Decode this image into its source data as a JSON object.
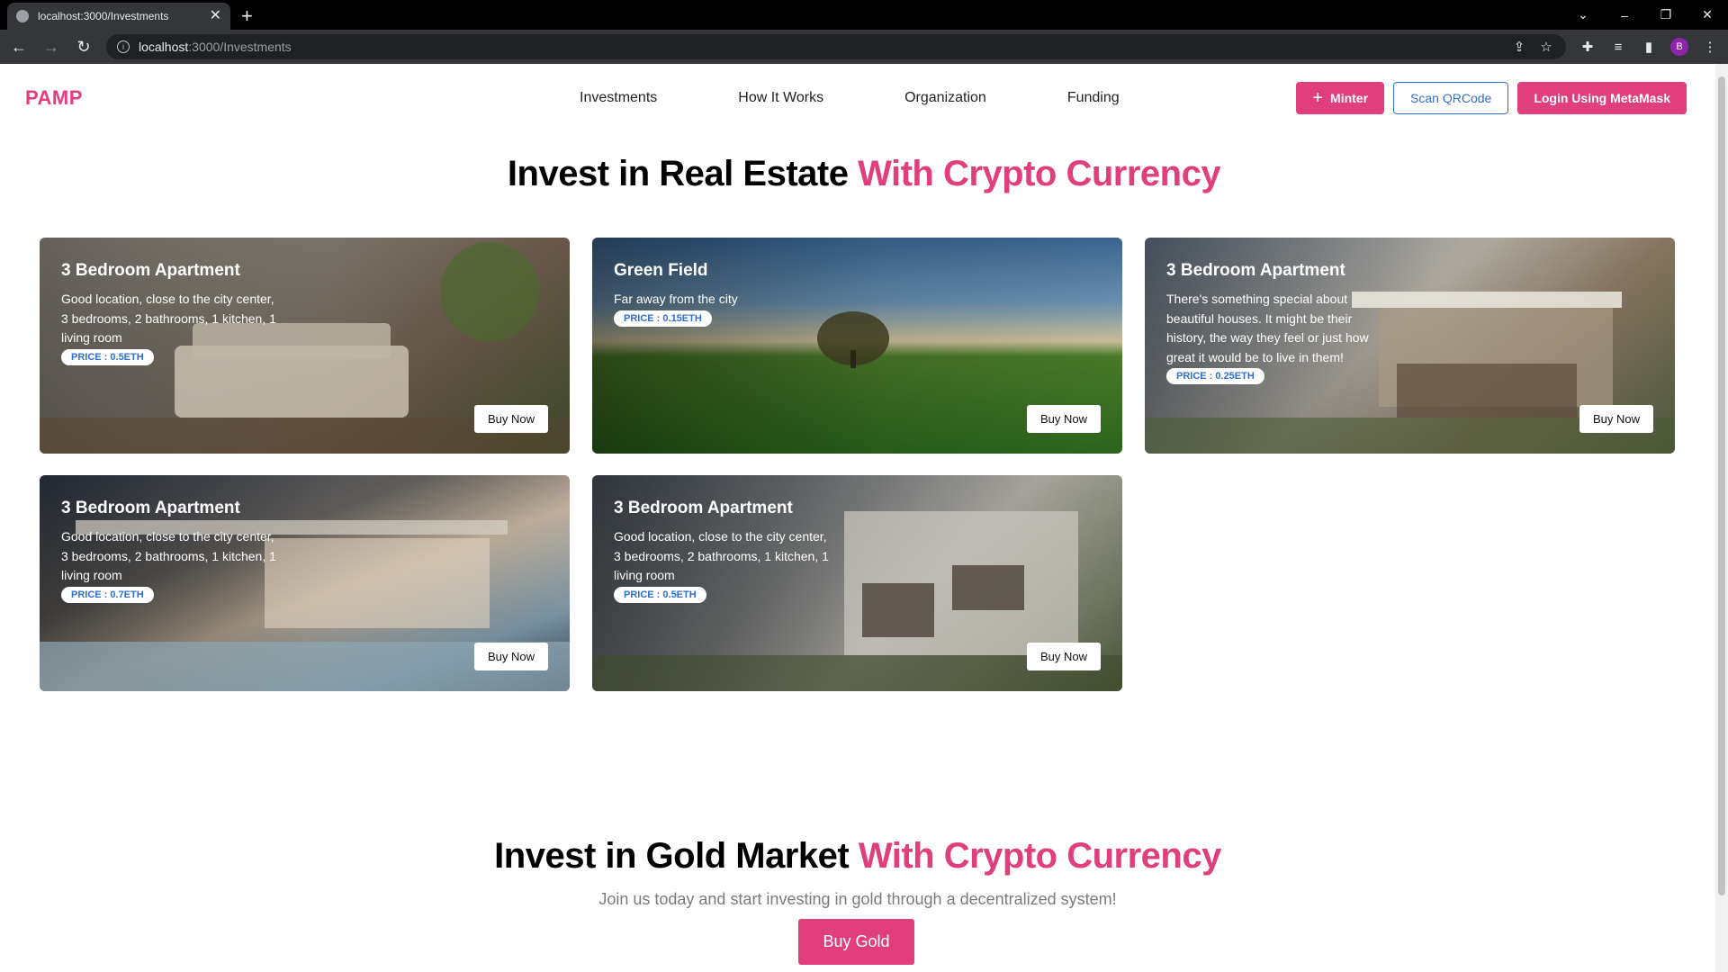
{
  "browser": {
    "tab_title": "localhost:3000/Investments",
    "url_host": "localhost",
    "url_path": ":3000/Investments",
    "profile_initial": "B"
  },
  "header": {
    "logo": "PAMP",
    "nav": [
      "Investments",
      "How It Works",
      "Organization",
      "Funding"
    ],
    "minter_label": "Minter",
    "scan_label": "Scan QRCode",
    "login_label": "Login Using MetaMask"
  },
  "hero": {
    "title_main": "Invest in Real Estate ",
    "title_accent": "With Crypto Currency"
  },
  "cards": [
    {
      "title": "3 Bedroom Apartment",
      "desc": "Good location, close to the city center, 3 bedrooms, 2 bathrooms, 1 kitchen, 1 living room",
      "price": "PRICE : 0.5ETH",
      "button": "Buy Now"
    },
    {
      "title": "Green Field",
      "desc": "Far away from the city",
      "price": "PRICE : 0.15ETH",
      "button": "Buy Now"
    },
    {
      "title": "3 Bedroom Apartment",
      "desc": "There's something special about beautiful houses. It might be their history, the way they feel or just how great it would be to live in them!",
      "price": "PRICE : 0.25ETH",
      "button": "Buy Now"
    },
    {
      "title": "3 Bedroom Apartment",
      "desc": "Good location, close to the city center, 3 bedrooms, 2 bathrooms, 1 kitchen, 1 living room",
      "price": "PRICE : 0.7ETH",
      "button": "Buy Now"
    },
    {
      "title": "3 Bedroom Apartment",
      "desc": "Good location, close to the city center, 3 bedrooms, 2 bathrooms, 1 kitchen, 1 living room",
      "price": "PRICE : 0.5ETH",
      "button": "Buy Now"
    }
  ],
  "gold": {
    "title_main": "Invest in Gold Market ",
    "title_accent": "With Crypto Currency",
    "subtitle": "Join us today and start investing in gold through a decentralized system!",
    "button": "Buy Gold"
  },
  "colors": {
    "accent": "#e03e7d",
    "link_blue": "#2f6fd1"
  }
}
